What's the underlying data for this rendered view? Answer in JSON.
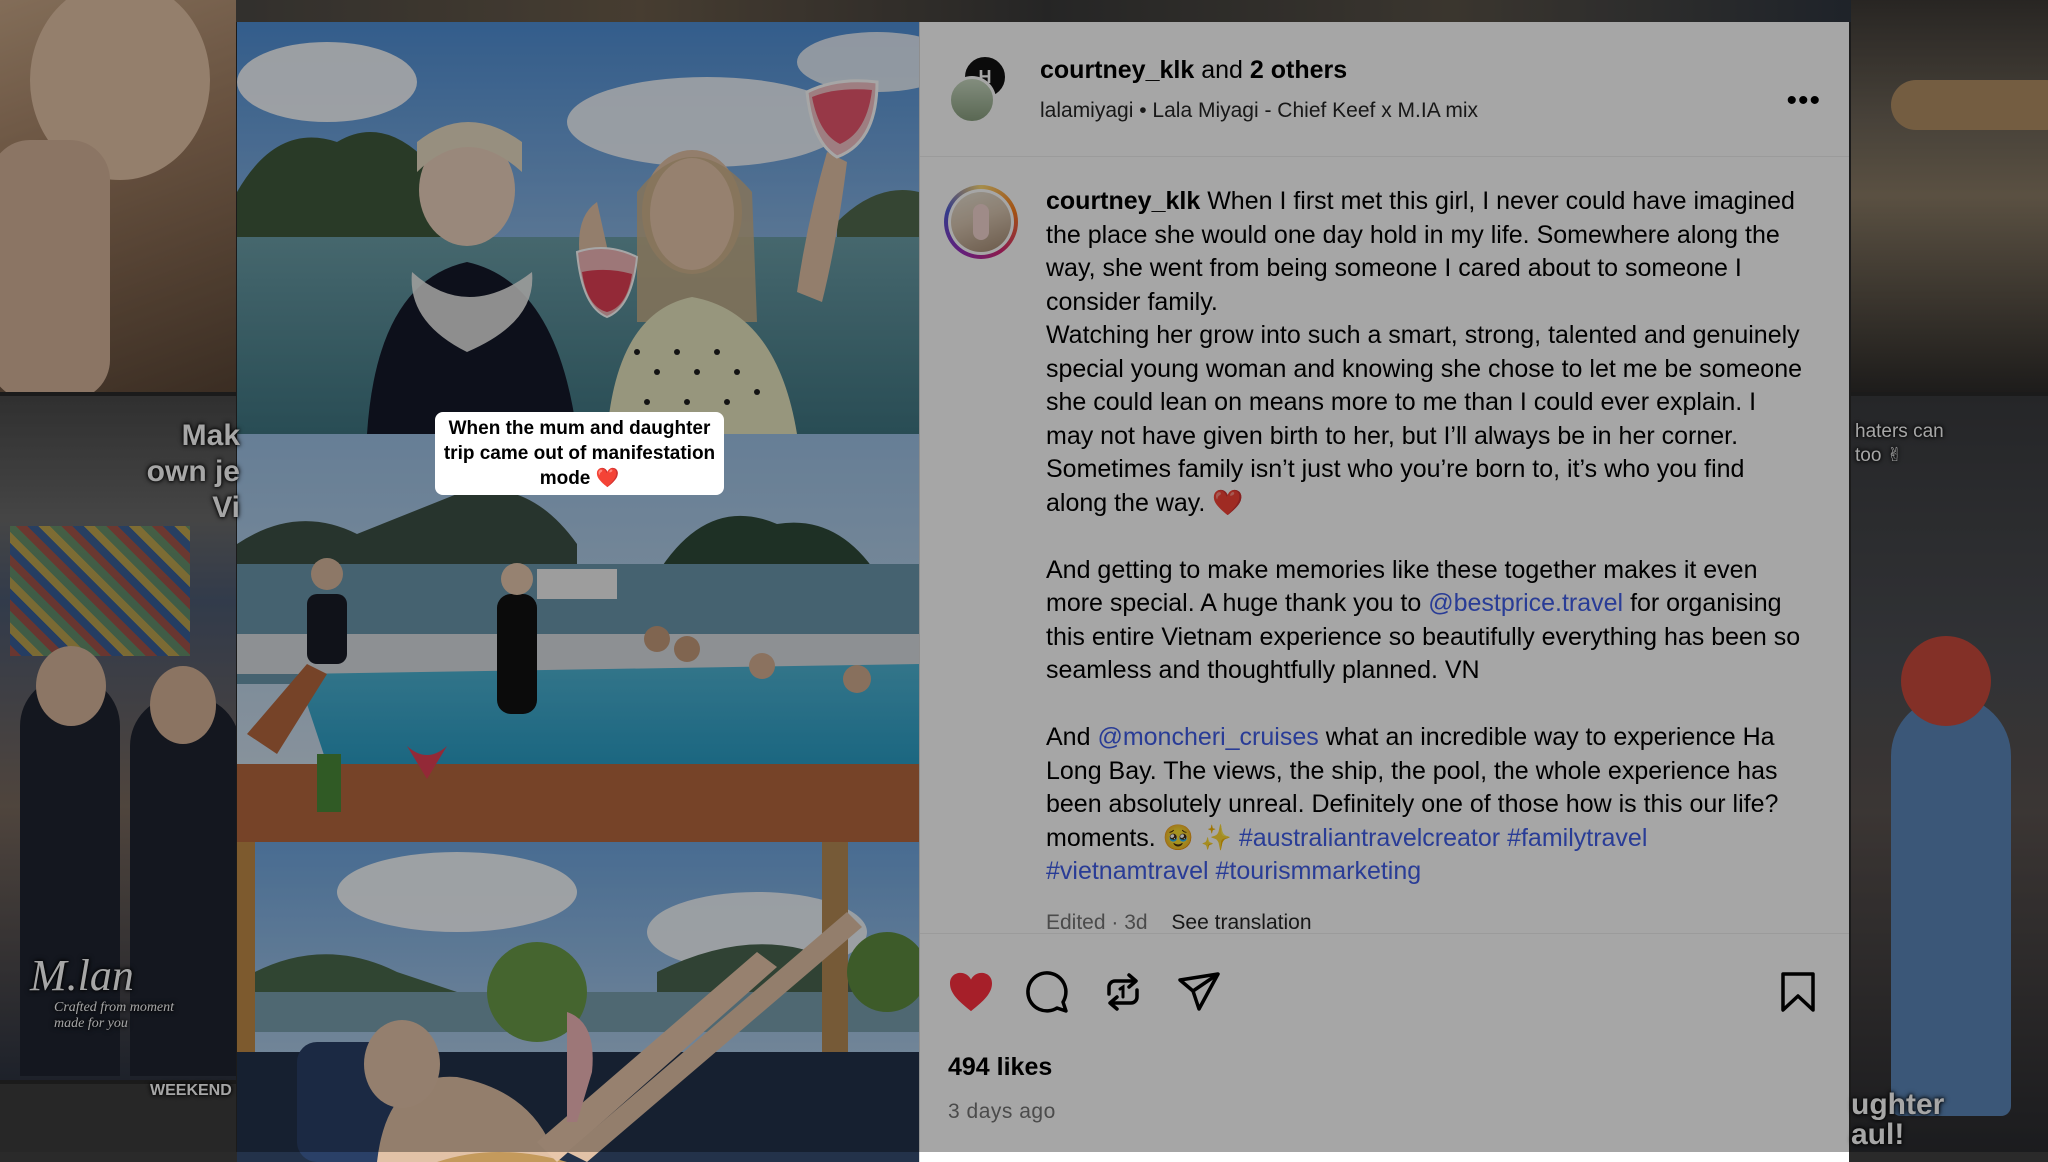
{
  "header": {
    "username": "courtney_klk",
    "and_text": "and",
    "others": "2 others",
    "audio_artist": "lalamiyagi",
    "audio_sep": "•",
    "audio_title": "Lala Miyagi - Chief Keef x M.IA mix",
    "avatar_letters": "H",
    "more_label": "•••"
  },
  "media": {
    "sticker_text": "When the mum and daughter trip came out of manifestation mode ❤️"
  },
  "background": {
    "tile_text_left": "Mak own je Vi",
    "tile_text_right": "haters can too ✌",
    "tile_text_bottom_left": "WEEKEND",
    "tile_text_bottom_right": "ughter aul!",
    "brand": "M.lan",
    "brand_sub": "Crafted from moment made for you"
  },
  "caption": {
    "username": "courtney_klk",
    "para1": "When I first met this girl, I never could have imagined the place she would one day hold in my life. Somewhere along the way, she went from being someone I cared about to someone I consider family.",
    "para2": "Watching her grow into such a smart, strong, talented and genuinely special young woman and knowing she chose to let me be someone she could lean on means more to me than I could ever explain. I may not have given birth to her, but I’ll always be in her corner. Sometimes family isn’t just who you’re born to, it’s who you find along the way.",
    "heart": "❤️",
    "para3_a": "And getting to make memories like these together makes it even more special. A huge thank you to",
    "mention1": "@bestprice.travel",
    "para3_b": "for organising this entire Vietnam experience so beautifully everything has been so seamless and thoughtfully planned. VN",
    "para4_a": "And",
    "mention2": "@moncheri_cruises",
    "para4_b": "what an incredible way to experience Ha Long Bay. The views, the ship, the pool, the whole experience has been absolutely unreal. Definitely one of those how is this our life? moments. 🥹 ✨",
    "tag1": "#australiantravelcreator",
    "tag2": "#familytravel",
    "tag3": "#vietnamtravel",
    "tag4": "#tourismmarketing",
    "edited": "Edited · 3d",
    "see_translation": "See translation"
  },
  "actions": {
    "like_icon": "heart-filled-icon",
    "comment_icon": "comment-icon",
    "repost_icon": "repost-icon",
    "share_icon": "share-icon",
    "save_icon": "bookmark-icon",
    "like_color": "#ff3040"
  },
  "stats": {
    "likes": "494 likes",
    "time": "3 days ago"
  }
}
